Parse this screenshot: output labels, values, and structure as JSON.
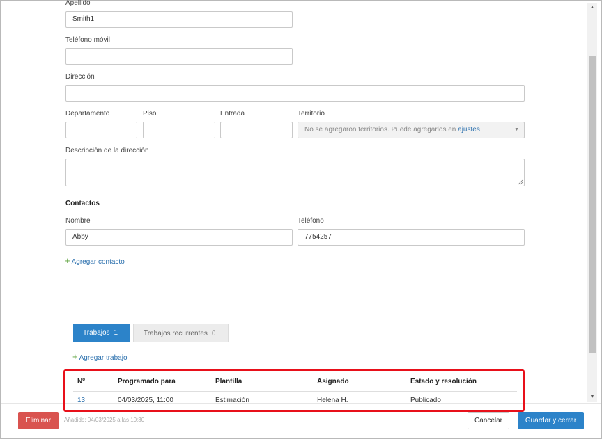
{
  "form": {
    "last_name_label": "Apellido",
    "last_name_value": "Smith1",
    "mobile_label": "Teléfono móvil",
    "mobile_value": "",
    "address_label": "Dirección",
    "address_value": "",
    "apartment_label": "Departamento",
    "floor_label": "Piso",
    "entrance_label": "Entrada",
    "territory_label": "Territorio",
    "territory_text": "No se agregaron territorios. Puede agregarlos en",
    "territory_link": "ajustes",
    "address_desc_label": "Descripción de la dirección"
  },
  "contacts": {
    "title": "Contactos",
    "name_label": "Nombre",
    "phone_label": "Teléfono",
    "name_value": "Abby",
    "phone_value": "7754257",
    "add_label": "Agregar contacto"
  },
  "tabs": [
    {
      "label": "Trabajos",
      "count": "1"
    },
    {
      "label": "Trabajos recurrentes",
      "count": "0"
    }
  ],
  "jobs": {
    "add_label": "Agregar trabajo",
    "columns": [
      "Nº",
      "Programado para",
      "Plantilla",
      "Asignado",
      "Estado y resolución"
    ],
    "rows": [
      {
        "number": "13",
        "scheduled": "04/03/2025, 11:00",
        "template": "Estimación",
        "assigned": "Helena H.",
        "status": "Publicado"
      }
    ]
  },
  "footer": {
    "delete_label": "Eliminar",
    "added_text": "Añadido: 04/03/2025 a las 10:30",
    "cancel_label": "Cancelar",
    "save_label": "Guardar y cerrar"
  },
  "colors": {
    "primary": "#2c83c9",
    "danger": "#d9534f",
    "highlight": "#e8101a",
    "link": "#2a6fad",
    "add_plus": "#5aa13a"
  },
  "icons": {
    "dropdown": "triangle-down",
    "add": "plus",
    "scroll_up": "triangle-up",
    "scroll_down": "triangle-down"
  }
}
